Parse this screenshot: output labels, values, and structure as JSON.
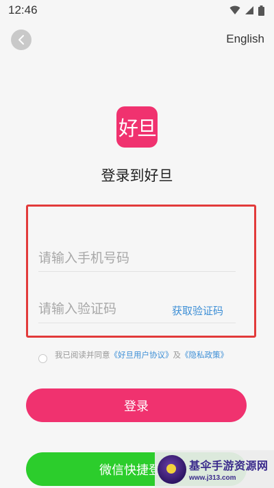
{
  "status_bar": {
    "time": "12:46",
    "icons": [
      "wifi-icon",
      "signal-icon",
      "battery-icon"
    ]
  },
  "header": {
    "back_icon": "chevron-left-icon",
    "language_label": "English"
  },
  "brand": {
    "logo_text": "好旦",
    "title": "登录到好旦",
    "accent_color": "#f0326f"
  },
  "form": {
    "phone_placeholder": "请输入手机号码",
    "phone_value": "",
    "code_placeholder": "请输入验证码",
    "code_value": "",
    "get_code_label": "获取验证码"
  },
  "agreement": {
    "checked": false,
    "prefix": "我已阅读并同意",
    "user_agreement": "《好旦用户协议》",
    "conjunction": "及",
    "privacy_policy": "《隐私政策》"
  },
  "actions": {
    "login_label": "登录",
    "wechat_label": "微信快捷登录",
    "wechat_color": "#2ccd2c"
  },
  "watermark": {
    "title": "基伞手游资源网",
    "url": "www.j313.com"
  }
}
